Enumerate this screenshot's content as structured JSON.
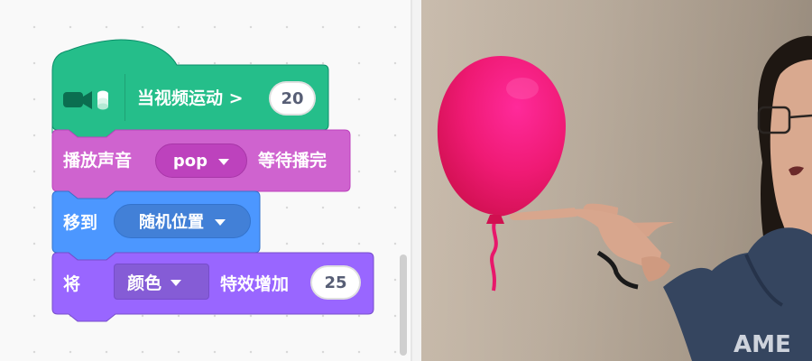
{
  "blocks": {
    "video_hat": {
      "label": "当视频运动 >",
      "value": "20",
      "icon": "video-sensing-icon",
      "color": "#25be8a"
    },
    "play_sound": {
      "label_before": "播放声音",
      "sound": "pop",
      "label_after": "等待播完",
      "color": "#cf63cf"
    },
    "go_to": {
      "label": "移到",
      "target": "随机位置",
      "color": "#4c97ff"
    },
    "change_effect": {
      "label": "将",
      "effect": "颜色",
      "label_mid": "特效增加",
      "value": "25",
      "color": "#9966ff"
    }
  },
  "stage": {
    "sprite": "balloon",
    "balloon_color": "#e8176b",
    "text_on_shirt": "AME"
  }
}
